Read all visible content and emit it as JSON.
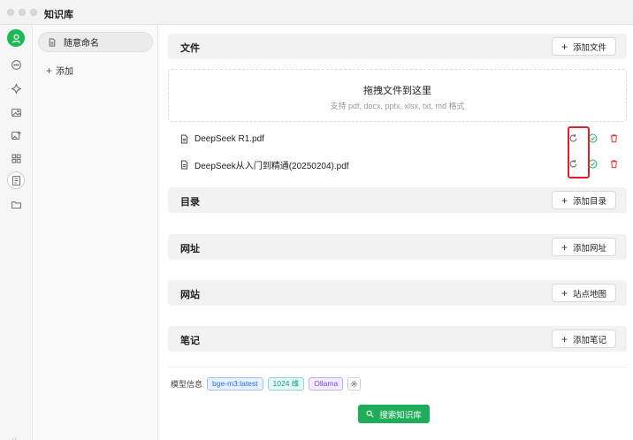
{
  "window": {
    "title": "知识库"
  },
  "iconbar": {
    "items": [
      {
        "icon": "avatar-icon"
      },
      {
        "icon": "chat-icon"
      },
      {
        "icon": "sparkle-icon"
      },
      {
        "icon": "image-icon"
      },
      {
        "icon": "image-edit-icon"
      },
      {
        "icon": "grid-icon"
      },
      {
        "icon": "knowledge-base-icon"
      },
      {
        "icon": "folder-icon"
      }
    ]
  },
  "kb_panel": {
    "items": [
      {
        "label": "随意命名",
        "icon": "document-icon"
      }
    ],
    "add_label": "添加"
  },
  "sections": {
    "files": {
      "title": "文件",
      "button": "添加文件"
    },
    "directories": {
      "title": "目录",
      "button": "添加目录"
    },
    "urls": {
      "title": "网址",
      "button": "添加网址"
    },
    "websites": {
      "title": "网站",
      "button": "站点地图"
    },
    "notes": {
      "title": "笔记",
      "button": "添加笔记"
    }
  },
  "dropzone": {
    "title": "拖拽文件到这里",
    "subtitle": "支持 pdf, docx, pptx, xlsx, txt, md 格式"
  },
  "files": [
    {
      "name": "DeepSeek R1.pdf",
      "status": "processed"
    },
    {
      "name": "DeepSeek从入门到精通(20250204).pdf",
      "status": "processed"
    }
  ],
  "model_info": {
    "label": "模型信息",
    "model": "bge-m3:latest",
    "dimensions": "1024 维",
    "provider": "Ollama"
  },
  "search_button": "搜索知识库",
  "colors": {
    "accent_green": "#1fad5a",
    "status_ok": "#22b35e",
    "delete_red": "#e53935",
    "highlight_red": "#e0202a"
  }
}
